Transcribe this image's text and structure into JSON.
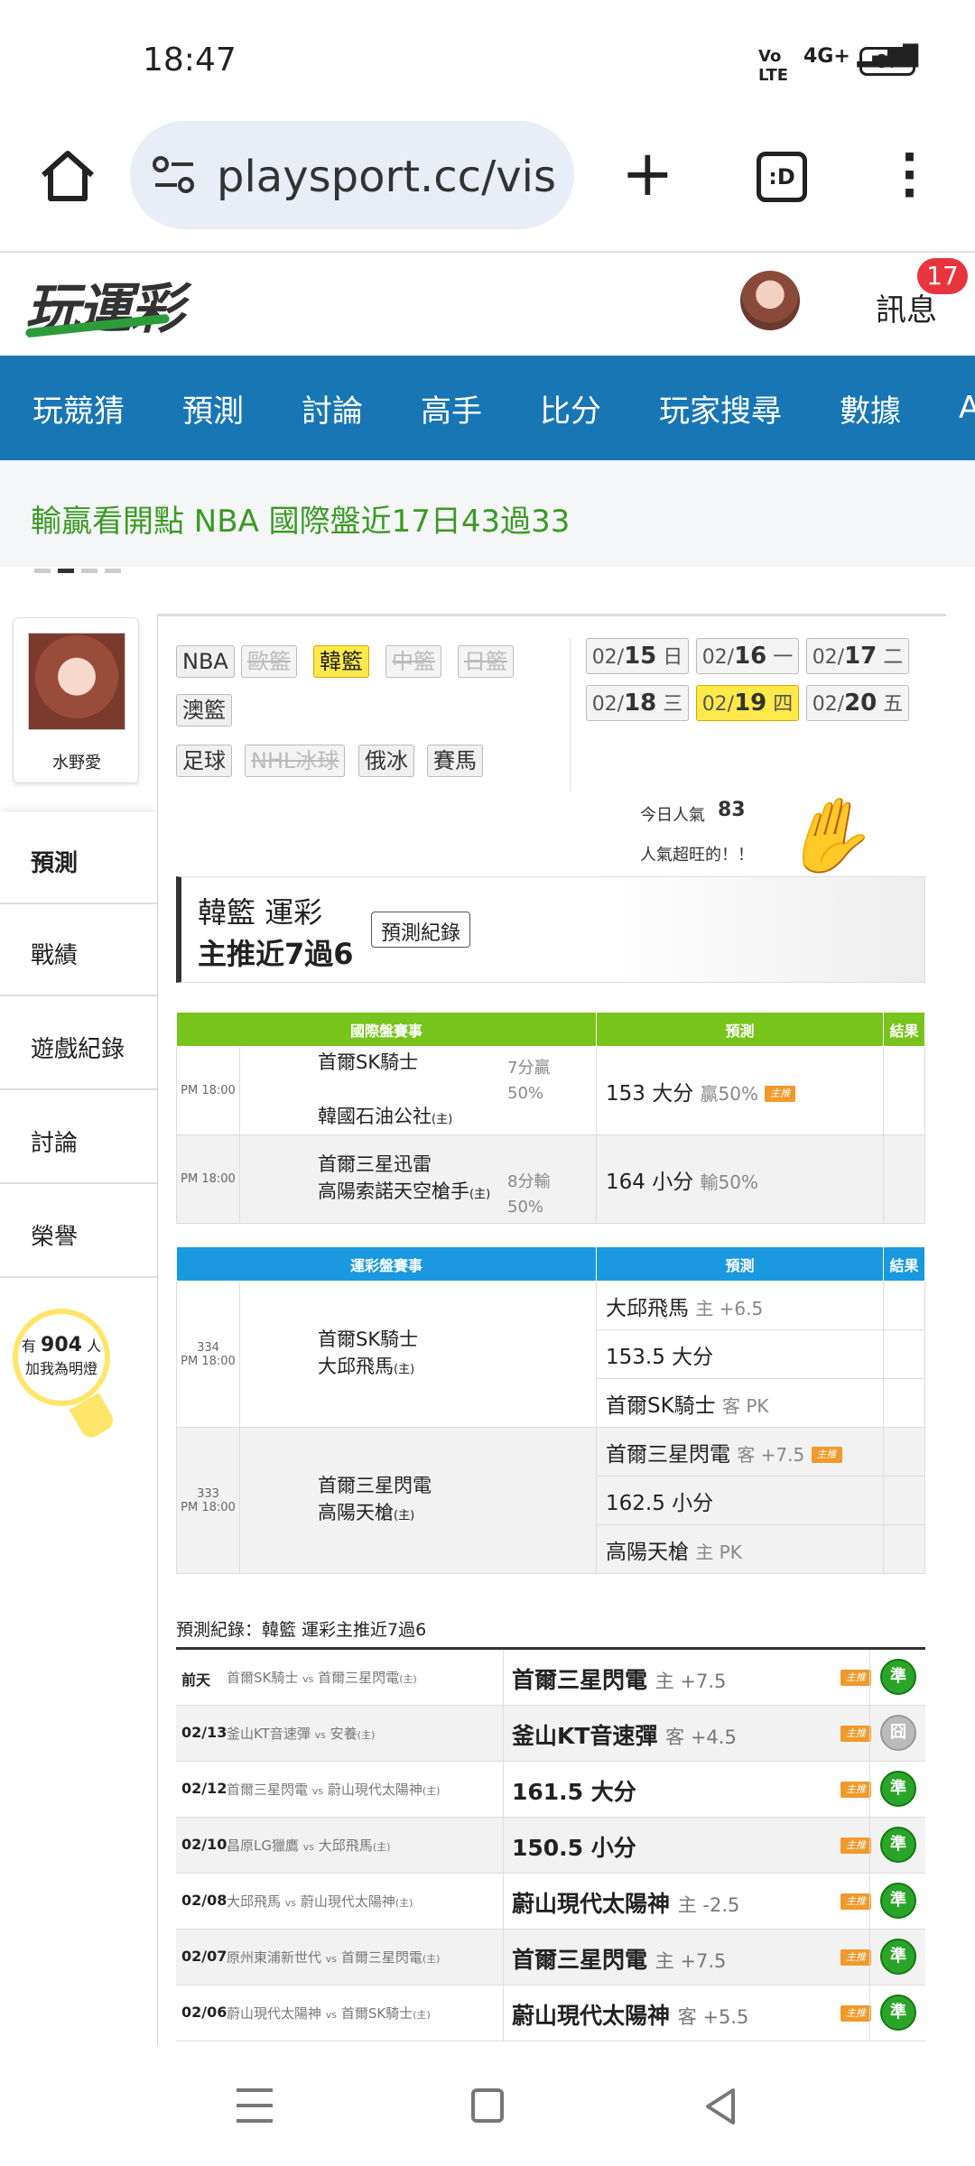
{
  "status": {
    "time": "18:47",
    "net": "4G+",
    "battery": "87"
  },
  "browser": {
    "url": "playsport.cc/visit",
    "tabs": ":D"
  },
  "site": {
    "logo": "玩運彩",
    "messages": "訊息",
    "badge": "17"
  },
  "nav": [
    "玩競猜",
    "預測",
    "討論",
    "高手",
    "比分",
    "玩家搜尋",
    "數據",
    "APP"
  ],
  "marquee": "輸贏看開點 NBA 國際盤近17日43過33",
  "profile": {
    "name": "水野愛"
  },
  "sidebar": [
    "預測",
    "戰績",
    "遊戲紀錄",
    "討論",
    "榮譽"
  ],
  "fans": {
    "pre": "有",
    "count": "904",
    "post": "人",
    "sub": "加我為明燈"
  },
  "leagues": {
    "row1": [
      "NBA",
      "歐籃",
      "韓籃",
      "中籃",
      "日籃"
    ],
    "row2": [
      "澳籃"
    ],
    "row3": [
      "足球",
      "NHL冰球",
      "俄冰",
      "賽馬"
    ]
  },
  "dates": [
    {
      "m": "02/",
      "d": "15",
      "w": "日"
    },
    {
      "m": "02/",
      "d": "16",
      "w": "一"
    },
    {
      "m": "02/",
      "d": "17",
      "w": "二"
    },
    {
      "m": "02/",
      "d": "18",
      "w": "三"
    },
    {
      "m": "02/",
      "d": "19",
      "w": "四"
    },
    {
      "m": "02/",
      "d": "20",
      "w": "五"
    }
  ],
  "popularity": {
    "label": "今日人氣",
    "value": "83",
    "note": "人氣超旺的！！"
  },
  "title": {
    "line1": "韓籃 運彩",
    "line2": "主推近7過6",
    "button": "預測紀錄"
  },
  "intl": {
    "h1": "國際盤賽事",
    "h2": "預測",
    "h3": "結果",
    "rows": [
      {
        "time": "PM 18:00",
        "away": "首爾SK騎士",
        "home": "韓國石油公社",
        "res1": "7分贏",
        "res2": "50%",
        "pick": "153 大分",
        "sub": "贏50%",
        "badge": "主推"
      },
      {
        "time": "PM 18:00",
        "away": "首爾三星迅雷",
        "home": "高陽索諾天空槍手",
        "res1": "8分輸",
        "res2": "50%",
        "pick": "164 小分",
        "sub": "輸50%"
      }
    ]
  },
  "sport": {
    "h1": "運彩盤賽事",
    "h2": "預測",
    "h3": "結果",
    "games": [
      {
        "num": "334",
        "time": "PM 18:00",
        "away": "首爾SK騎士",
        "home": "大邱飛馬",
        "picks": [
          {
            "t": "大邱飛馬",
            "s": "主 +6.5"
          },
          {
            "t": "153.5 大分",
            "s": ""
          },
          {
            "t": "首爾SK騎士",
            "s": "客 PK"
          }
        ]
      },
      {
        "num": "333",
        "time": "PM 18:00",
        "away": "首爾三星閃電",
        "home": "高陽天槍",
        "picks": [
          {
            "t": "首爾三星閃電",
            "s": "客 +7.5",
            "badge": "主推"
          },
          {
            "t": "162.5 小分",
            "s": ""
          },
          {
            "t": "高陽天槍",
            "s": "主 PK"
          }
        ]
      }
    ]
  },
  "home_mark": "(主)",
  "record": {
    "label": "預測紀錄：韓籃 運彩主推近7過6",
    "rows": [
      {
        "date": "前天",
        "a": "首爾SK騎士",
        "b": "首爾三星閃電",
        "pick": "首爾三星閃電",
        "s": "主 +7.5",
        "r": "準"
      },
      {
        "date": "02/13",
        "a": "釜山KT音速彈",
        "b": "安養",
        "pick": "釜山KT音速彈",
        "s": "客 +4.5",
        "r": "囧"
      },
      {
        "date": "02/12",
        "a": "首爾三星閃電",
        "b": "蔚山現代太陽神",
        "pick": "161.5 大分",
        "s": "",
        "r": "準"
      },
      {
        "date": "02/10",
        "a": "昌原LG獵鷹",
        "b": "大邱飛馬",
        "pick": "150.5 小分",
        "s": "",
        "r": "準"
      },
      {
        "date": "02/08",
        "a": "大邱飛馬",
        "b": "蔚山現代太陽神",
        "pick": "蔚山現代太陽神",
        "s": "主 -2.5",
        "r": "準"
      },
      {
        "date": "02/07",
        "a": "原州東浦新世代",
        "b": "首爾三星閃電",
        "pick": "首爾三星閃電",
        "s": "主 +7.5",
        "r": "準"
      },
      {
        "date": "02/06",
        "a": "蔚山現代太陽神",
        "b": "首爾SK騎士",
        "pick": "蔚山現代太陽神",
        "s": "客 +5.5",
        "r": "準"
      }
    ],
    "badge": "主推",
    "vs": "vs"
  }
}
